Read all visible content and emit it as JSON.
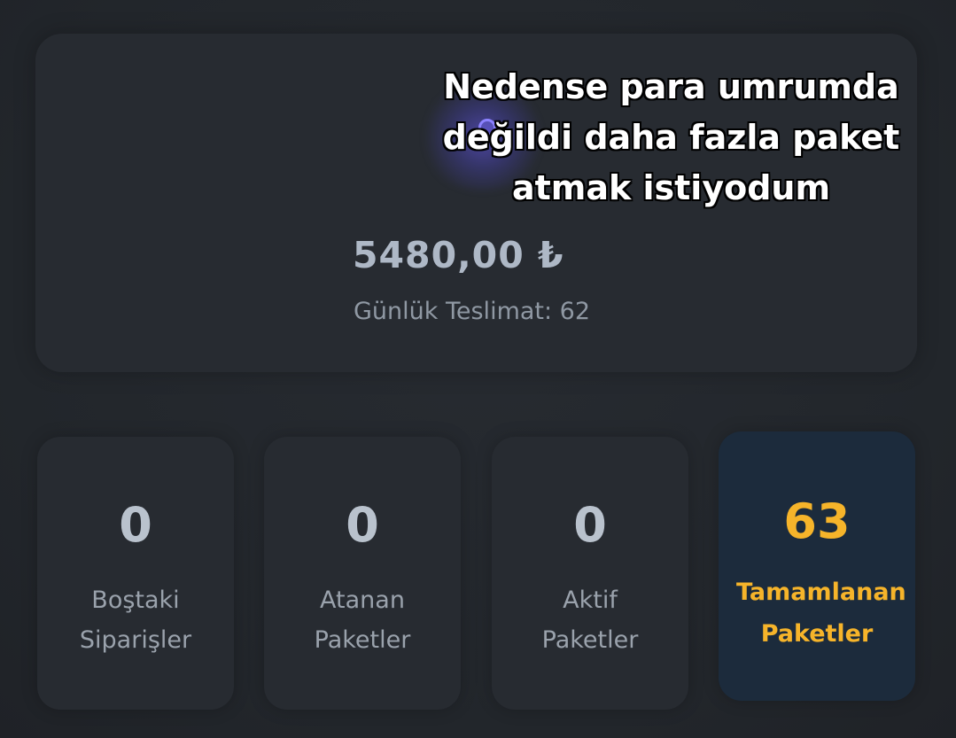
{
  "summary": {
    "earnings": "5480,00 ₺",
    "daily_deliveries": "Günlük Teslimat: 62"
  },
  "caption": {
    "line1": "Nedense para umrumda",
    "line2": "değildi daha fazla paket",
    "line3": "atmak istiyodum"
  },
  "stats": [
    {
      "value": "0",
      "label_line1": "Boştaki",
      "label_line2": "Siparişler"
    },
    {
      "value": "0",
      "label_line1": "Atanan",
      "label_line2": "Paketler"
    },
    {
      "value": "0",
      "label_line1": "Aktif",
      "label_line2": "Paketler"
    },
    {
      "value": "63",
      "label_line1": "Tamamlanan",
      "label_line2": "Paketler"
    }
  ],
  "colors": {
    "background": "#22262b",
    "card": "#272b31",
    "highlight_card": "#1c2b3c",
    "accent": "#f6b42a"
  }
}
